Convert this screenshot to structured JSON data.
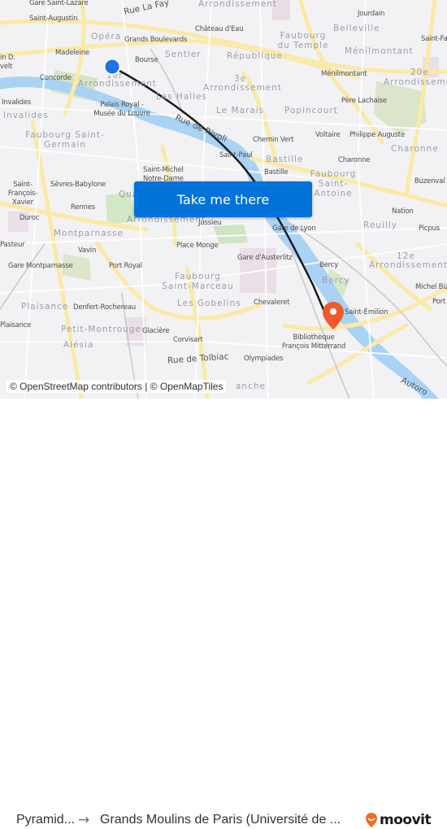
{
  "map": {
    "labels": {
      "gare_saint_lazare": "Gare Saint-Lazare",
      "rue_la_fayette": "Rue La Fay",
      "arrondissement_top": "Arrondissement",
      "saint_augustin": "Saint-Augustin",
      "opera": "Opéra",
      "grands_boulevards": "Grands Boulevards",
      "chateau_deau": "Château d'Eau",
      "faubourg_du_temple": "Faubourg du Temple",
      "belleville": "Belleville",
      "jourdain": "Jourdain",
      "saint_fargeau": "Saint-Fa",
      "menilmontant_dist": "Ménilmontant",
      "menilmontant_poi": "Ménilmontant",
      "republique": "République",
      "madeleine": "Madeleine",
      "bourse": "Bourse",
      "sentier": "Sentier",
      "concorde": "Concorde",
      "first_arr_num": "1er",
      "first_arr": "Arrondissement",
      "third_arr_num": "3e",
      "third_arr": "Arrondissement",
      "twentieth_num": "20e",
      "twentieth_arr": "Arrondissement",
      "roosevelt": "in D. velt",
      "invalides_poi": "Invalides",
      "invalides_dist": "Invalides",
      "palais_royal": "Palais Royal - Musée du Louvre",
      "les_halles": "Les Halles",
      "le_marais": "Le Marais",
      "popincourt": "Popincourt",
      "pere_lachaise": "Père Lachaise",
      "rue_de_rivoli": "Rue de Rivoli",
      "chemin_vert": "Chemin Vert",
      "voltaire": "Voltaire",
      "philippe_auguste": "Philippe Auguste",
      "charonne_dist": "Charonne",
      "charonne_poi": "Charonne",
      "faubourg_saint_germain": "Faubourg Saint-Germain",
      "saint_paul": "Saint-Paul",
      "bastille_dist": "Bastille",
      "bastille_poi": "Bastille",
      "saint_michel": "Saint-Michel Notre-Dame",
      "faubourg_saint_antoine": "Faubourg Saint-Antoine",
      "buzenval": "Buzenval",
      "saint_francois_xavier": "Saint-François-Xavier",
      "sevres_babylone": "Sèvres-Babylone",
      "quartier_latin": "Qua",
      "fifth_arr": "Arrondissement",
      "duroc": "Duroc",
      "rennes": "Rennes",
      "jussieu": "Jussieu",
      "gare_de_lyon": "Gare de Lyon",
      "nation": "Nation",
      "reuilly": "Reuilly",
      "picpus": "Picpus",
      "montparnasse": "Montparnasse",
      "pasteur": "Pasteur",
      "vavin": "Vavin",
      "place_monge": "Place Monge",
      "gare_montparnasse": "Gare Montparnasse",
      "port_royal": "Port Royal",
      "gare_austerlitz": "Gare d'Austerlitz",
      "bercy_poi": "Bercy",
      "bercy_dist": "Bercy",
      "twelfth_num": "12e",
      "twelfth_arr": "Arrondissement",
      "faubourg_saint_marceau": "Faubourg Saint-Marceau",
      "michel_bizot": "Michel Bizo",
      "plaisance_dist": "Plaisance",
      "denfert": "Denfert-Rochereau",
      "les_gobelins": "Les Gobelins",
      "chevaleret": "Chevaleret",
      "saint_emilion": "Saint-Émilion",
      "porte": "Port",
      "plaisance_poi": "Plaisance",
      "petit_montrouge": "Petit-Montrouge",
      "glaciere": "Glacière",
      "corvisart": "Corvisart",
      "bibliotheque": "Bibliothèque François Mitterrand",
      "alesia": "Alésia",
      "rue_de_tolbiac": "Rue de Tolbiac",
      "olympiades": "Olympiades",
      "autoroute": "Autoro",
      "blanche": "anche"
    },
    "origin_marker_color": "#1a73e8",
    "destination_marker_color": "#f05a28",
    "route_color": "#1b1b1b"
  },
  "cta": {
    "label": "Take me there",
    "color": "#0072d8"
  },
  "attribution": "© OpenStreetMap contributors | © OpenMapTiles",
  "footer": {
    "from": "Pyramid...",
    "arrow": "→",
    "to": "Grands Moulins de Paris (Université de ...",
    "brand": "moovit",
    "brand_color": "#f26b21"
  }
}
